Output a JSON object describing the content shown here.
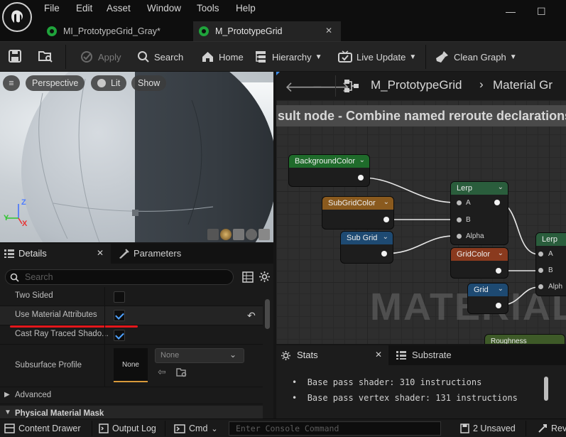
{
  "menu": {
    "items": [
      "File",
      "Edit",
      "Asset",
      "Window",
      "Tools",
      "Help"
    ]
  },
  "window_controls": {
    "minimize": "—",
    "maximize": "☐"
  },
  "tabs": [
    {
      "label": "MI_PrototypeGrid_Gray*",
      "active": false
    },
    {
      "label": "M_PrototypeGrid",
      "active": true,
      "close": "✕"
    }
  ],
  "toolbar": {
    "apply": "Apply",
    "search": "Search",
    "home": "Home",
    "hierarchy": "Hierarchy",
    "live_update": "Live Update",
    "clean_graph": "Clean Graph"
  },
  "viewport": {
    "perspective": "Perspective",
    "lit": "Lit",
    "show": "Show",
    "axis_z": "Z",
    "axis_y": "Y",
    "axis_x": "X"
  },
  "graph": {
    "breadcrumb_root": "M_PrototypeGrid",
    "breadcrumb_child": "Material Gr",
    "comment": "sult node - Combine named reroute declarations",
    "watermark": "MATERIAL",
    "nodes": {
      "background_color": "BackgroundColor",
      "sub_grid_color": "SubGridColor",
      "sub_grid": "Sub Grid",
      "lerp1": {
        "title": "Lerp",
        "pins": [
          "A",
          "B",
          "Alpha"
        ]
      },
      "grid_color": "GridColor",
      "grid": "Grid",
      "lerp2": {
        "title": "Lerp",
        "pins": [
          "A",
          "B",
          "Alph"
        ]
      },
      "roughness": "Roughness"
    },
    "colors": {
      "background_color_header": "#1f6b2b",
      "sub_grid_color_header": "#8a5a1e",
      "sub_grid_header": "#1e4a72",
      "lerp_header": "#2a5d3c",
      "grid_color_header": "#8a3a1e",
      "grid_header": "#1e4a72",
      "roughness_header": "#3e5a28"
    }
  },
  "details": {
    "tab_details": "Details",
    "tab_parameters": "Parameters",
    "search_placeholder": "Search",
    "properties": [
      {
        "name": "Two Sided",
        "checked": false
      },
      {
        "name": "Use Material Attributes",
        "checked": true
      },
      {
        "name": "Cast Ray Traced Shado...",
        "checked": true
      }
    ],
    "subsurface_profile": {
      "name": "Subsurface Profile",
      "thumb": "None",
      "dropdown": "None"
    },
    "advanced": "Advanced",
    "physical_material_mask": "Physical Material Mask"
  },
  "stats": {
    "tab_stats": "Stats",
    "tab_substrate": "Substrate",
    "lines": [
      "Base pass shader: 310 instructions",
      "Base pass vertex shader: 131 instructions"
    ]
  },
  "statusbar": {
    "content_drawer": "Content Drawer",
    "output_log": "Output Log",
    "cmd": "Cmd",
    "console_placeholder": "Enter Console Command",
    "unsaved": "2 Unsaved",
    "revision": "Rev"
  }
}
